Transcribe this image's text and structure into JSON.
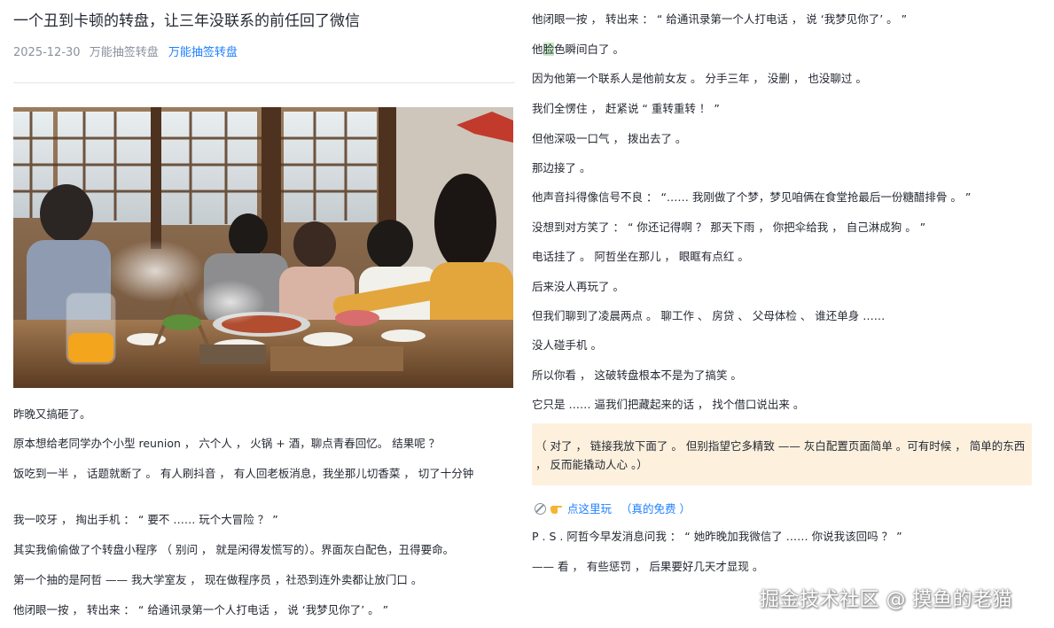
{
  "article": {
    "title": "一个丑到卡顿的转盘，让三年没联系的前任回了微信",
    "date": "2025-12-30",
    "category": "万能抽签转盘",
    "tag": "万能抽签转盘"
  },
  "left_paragraphs": [
    "昨晚又搞砸了。",
    "原本想给老同学办个小型 reunion ， 六个人 ， 火锅 + 酒，聊点青春回忆。 结果呢 ？",
    "饭吃到一半 ， 话题就断了 。 有人刷抖音 ， 有人回老板消息，我坐那儿切香菜 ， 切了十分钟",
    "我一咬牙 ， 掏出手机 ： “ 要不 …… 玩个大冒险 ？ ”",
    "其实我偷偷做了个转盘小程序 （ 别问 ， 就是闲得发慌写的）。界面灰白配色，丑得要命。",
    "第一个抽的是阿哲 —— 我大学室友 ， 现在做程序员 ，社恐到连外卖都让放门口 。",
    "他闭眼一按 ， 转出来 ： “ 给通讯录第一个人打电话 ， 说 ‘我梦见你了’ 。 ”"
  ],
  "right_paragraphs": [
    "他闭眼一按 ， 转出来 ： “ 给通讯录第一个人打电话 ， 说 ‘我梦见你了’ 。 ”",
    "他脸色瞬间白了 。",
    "因为他第一个联系人是他前女友 。 分手三年 ， 没删 ， 也没聊过 。",
    "我们全愣住 ， 赶紧说 “ 重转重转 ！ ”",
    "但他深吸一口气 ， 拨出去了 。",
    "那边接了 。",
    "他声音抖得像信号不良 ： “…… 我刚做了个梦，梦见咱俩在食堂抢最后一份糖醋排骨 。 ”",
    "没想到对方笑了 ： “ 你还记得啊 ？ 那天下雨 ， 你把伞给我 ， 自己淋成狗 。 ”",
    "电话挂了 。 阿哲坐在那儿 ， 眼眶有点红 。",
    "后来没人再玩了 。",
    "但我们聊到了凌晨两点 。 聊工作 、 房贷 、 父母体检 、 谁还单身 ……",
    "没人碰手机 。",
    "所以你看 ， 这破转盘根本不是为了搞笑 。",
    "它只是 …… 逼我们把藏起来的话 ， 找个借口说出来 。"
  ],
  "highlight": {
    "before": "他",
    "word": "脸",
    "after": "色瞬间白了 。"
  },
  "callout": "（ 对了 ， 链接我放下面了 。 但别指望它多精致 —— 灰白配置页面简单 。可有时候 ， 简单的东西 ， 反而能撬动人心 。）",
  "link": {
    "label": "点这里玩",
    "note": "（真的免费 ）"
  },
  "ps": [
    "P . S . 阿哲今早发消息问我 ： “ 她昨晚加我微信了 …… 你说我该回吗 ？ ”",
    "—— 看 ， 有些惩罚 ， 后果要好几天才显现 。"
  ],
  "watermark": "掘金技术社区 @ 摸鱼的老猫",
  "colors": {
    "link": "#1e80ff",
    "meta": "#8a919f",
    "callout_bg": "#fdf1de",
    "highlight": "#c7e8c3"
  },
  "icons": [
    "link-circle-icon",
    "pointing-hand-icon"
  ]
}
